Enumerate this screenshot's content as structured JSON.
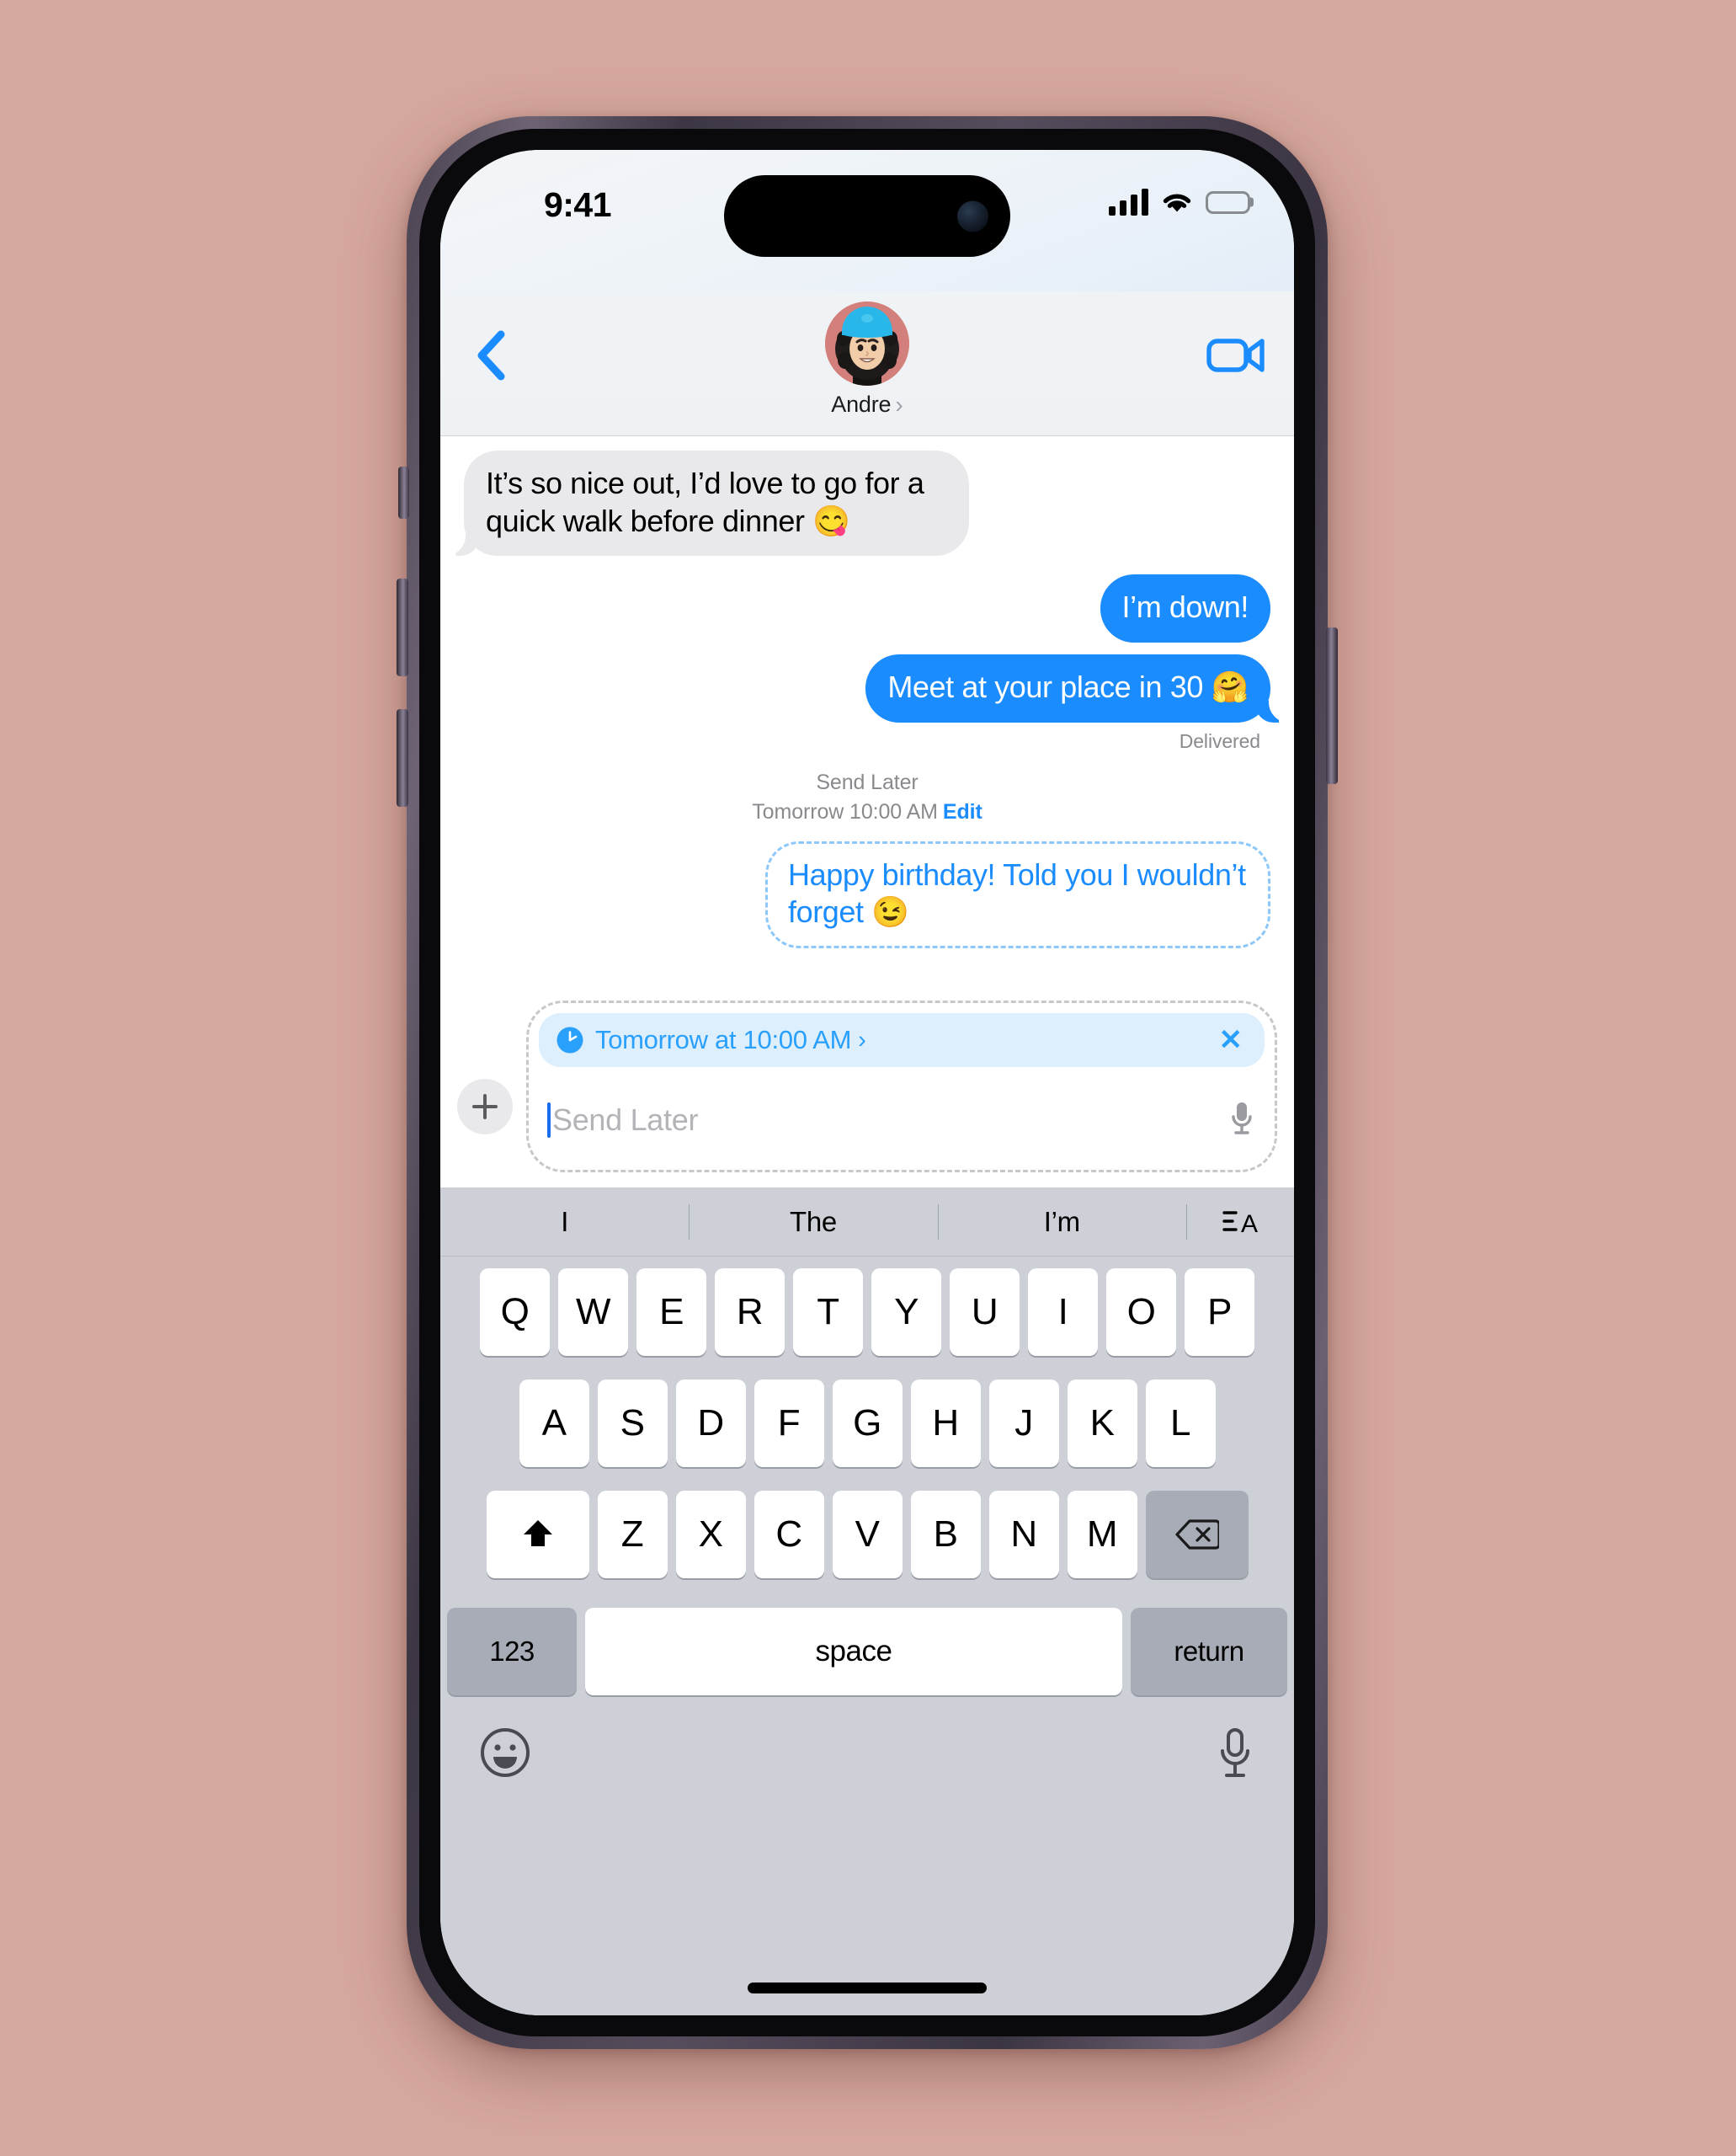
{
  "background_color": "#d6a79d",
  "accent_color": "#1b8cfe",
  "status_bar": {
    "time": "9:41",
    "signal_icon": "cellular-signal-icon",
    "wifi_icon": "wifi-icon",
    "battery_icon": "battery-full-icon"
  },
  "navbar": {
    "back_icon": "back-chevron-icon",
    "contact_name": "Andre",
    "contact_chevron": "›",
    "avatar_icon": "memoji-avatar",
    "facetime_icon": "video-camera-icon"
  },
  "conversation": {
    "messages": [
      {
        "direction": "incoming",
        "text": "It’s so nice out, I’d love to go for a quick walk before dinner 😋"
      },
      {
        "direction": "outgoing",
        "text": "I’m down!"
      },
      {
        "direction": "outgoing",
        "text": "Meet at your place in 30 🤗"
      }
    ],
    "delivered_status": "Delivered",
    "send_later": {
      "title": "Send Later",
      "time": "Tomorrow 10:00 AM",
      "edit_label": "Edit"
    },
    "scheduled_message": {
      "text": "Happy birthday! Told you I wouldn’t forget 😉"
    }
  },
  "input_area": {
    "plus_icon": "plus-icon",
    "schedule_chip": {
      "clock_icon": "clock-icon",
      "label": "Tomorrow at 10:00 AM",
      "chevron": "›",
      "clear_label": "✕"
    },
    "compose_placeholder": "Send Later",
    "mic_icon": "microphone-icon"
  },
  "keyboard": {
    "predictions": [
      "I",
      "The",
      "I’m"
    ],
    "format_icon": "text-format-icon",
    "row1": [
      "Q",
      "W",
      "E",
      "R",
      "T",
      "Y",
      "U",
      "I",
      "O",
      "P"
    ],
    "row2": [
      "A",
      "S",
      "D",
      "F",
      "G",
      "H",
      "J",
      "K",
      "L"
    ],
    "row3": [
      "Z",
      "X",
      "C",
      "V",
      "B",
      "N",
      "M"
    ],
    "shift_icon": "shift-up-arrow-icon",
    "backspace_icon": "backspace-delete-icon",
    "numeric_label": "123",
    "space_label": "space",
    "return_label": "return",
    "emoji_icon": "emoji-smiley-icon",
    "dictation_icon": "dictation-microphone-icon"
  }
}
